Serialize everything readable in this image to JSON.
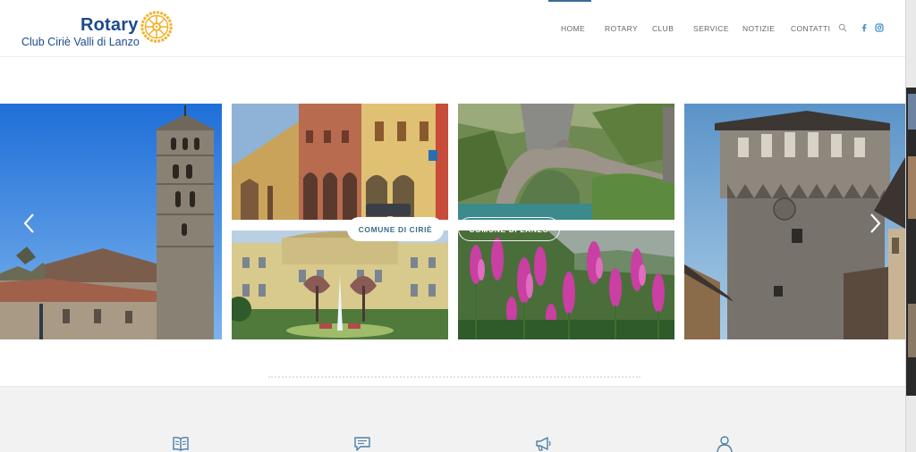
{
  "brand": {
    "wordmark": "Rotary",
    "club_name": "Club Ciriè Valli di Lanzo",
    "wheel_color": "#f2b22d",
    "brand_color": "#1d4a8c"
  },
  "nav": {
    "items": [
      {
        "label": "HOME",
        "active": true
      },
      {
        "label": "ROTARY"
      },
      {
        "label": "CLUB"
      },
      {
        "label": "SERVICE"
      },
      {
        "label": "NOTIZIE"
      },
      {
        "label": "CONTATTI"
      }
    ],
    "icons": [
      "search-icon",
      "facebook-icon",
      "instagram-icon"
    ],
    "accent_color": "#3d6b99"
  },
  "slider": {
    "slides": [
      {
        "icon": "bell-tower-photo"
      },
      {
        "icon": "arcaded-street-photo"
      },
      {
        "icon": "stone-bridge-photo"
      },
      {
        "icon": "palazzo-fountain-photo"
      },
      {
        "icon": "pink-flowers-photo"
      },
      {
        "icon": "medieval-tower-photo"
      }
    ],
    "captions": {
      "primary": "COMUNE DI CIRIÈ",
      "secondary": "COMUNE DI LANZO"
    },
    "prev_icon": "chevron-left-icon",
    "next_icon": "chevron-right-icon"
  },
  "features": {
    "icons": [
      "book-icon",
      "speech-bubble-icon",
      "megaphone-icon",
      "user-icon"
    ],
    "icon_color": "#4a7fa8"
  }
}
